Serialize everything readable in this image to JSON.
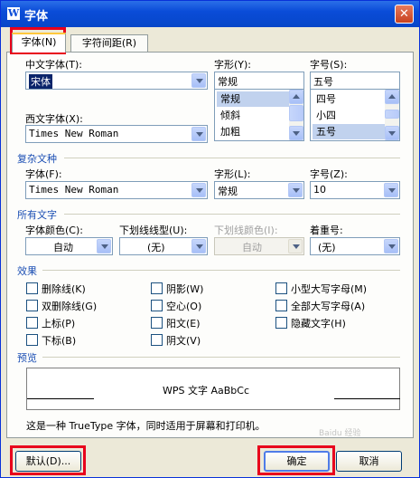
{
  "window": {
    "title": "字体",
    "title_icon_glyph": "W"
  },
  "tabs": [
    {
      "label": "字体(N)",
      "active": true
    },
    {
      "label": "字符间距(R)",
      "active": false
    }
  ],
  "latin_section": {
    "chinese_font_label": "中文字体(T):",
    "chinese_font_value": "宋体",
    "style_label": "字形(Y):",
    "style_value": "常规",
    "style_options": [
      "常规",
      "倾斜",
      "加粗"
    ],
    "size_label": "字号(S):",
    "size_value": "五号",
    "size_options": [
      "四号",
      "小四",
      "五号"
    ],
    "western_font_label": "西文字体(X):",
    "western_font_value": "Times New Roman"
  },
  "complex_section": {
    "heading": "复杂文种",
    "font_label": "字体(F):",
    "font_value": "Times New Roman",
    "style_label": "字形(L):",
    "style_value": "常规",
    "size_label": "字号(Z):",
    "size_value": "10"
  },
  "all_text_section": {
    "heading": "所有文字",
    "font_color_label": "字体颜色(C):",
    "font_color_value": "自动",
    "underline_type_label": "下划线线型(U):",
    "underline_type_value": "(无)",
    "underline_color_label": "下划线颜色(I):",
    "underline_color_value": "自动",
    "emphasis_label": "着重号:",
    "emphasis_value": "(无)"
  },
  "effects_section": {
    "heading": "效果",
    "options": [
      "删除线(K)",
      "双删除线(G)",
      "上标(P)",
      "下标(B)",
      "阴影(W)",
      "空心(O)",
      "阳文(E)",
      "阴文(V)",
      "小型大写字母(M)",
      "全部大写字母(A)",
      "隐藏文字(H)"
    ]
  },
  "preview_section": {
    "heading": "预览",
    "sample_text": "WPS 文字 AaBbCc",
    "description": "这是一种 TrueType 字体，同时适用于屏幕和打印机。"
  },
  "buttons": {
    "default_label": "默认(D)...",
    "ok_label": "确定",
    "cancel_label": "取消"
  },
  "watermark": {
    "text": "Baidu 经验"
  },
  "colors": {
    "selection": "#0a246a",
    "highlight_box": "#e8001c",
    "section_heading": "#1c4fb4"
  }
}
